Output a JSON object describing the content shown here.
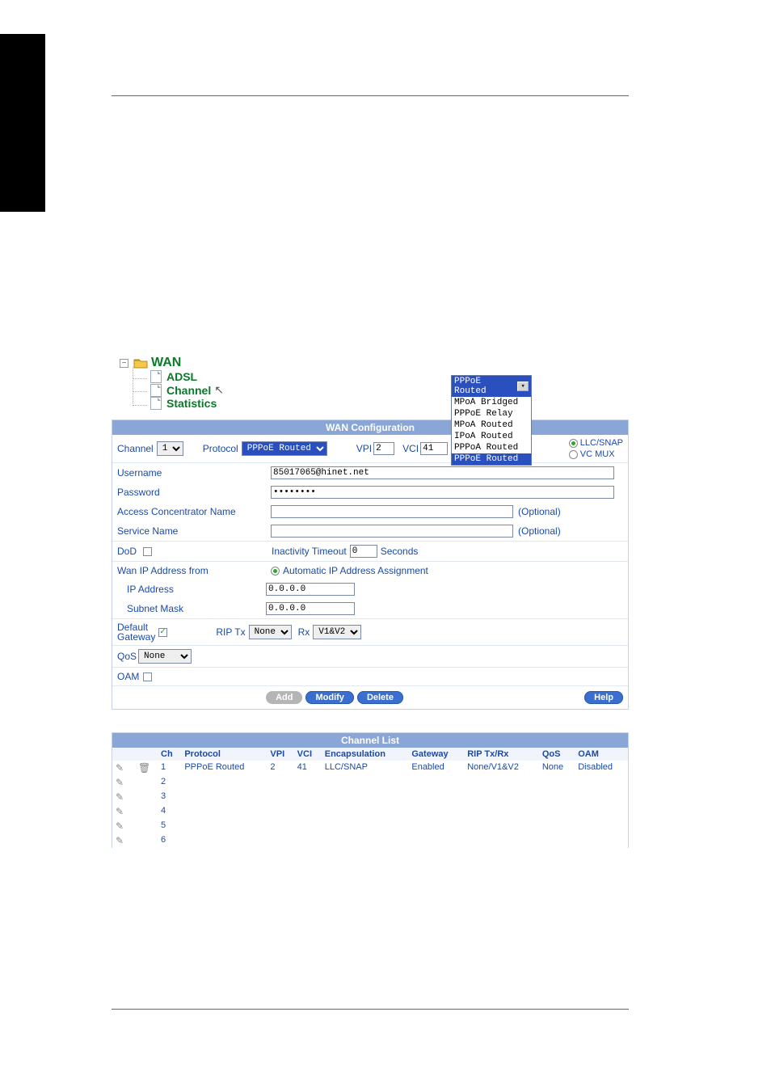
{
  "tree": {
    "root": "WAN",
    "items": [
      "ADSL",
      "Channel",
      "Statistics"
    ]
  },
  "protocol_dropdown": {
    "selected": "PPPoE Routed",
    "options": [
      "MPoA Bridged",
      "PPPoE Relay",
      "MPoA Routed",
      "IPoA Routed",
      "PPPoA Routed",
      "PPPoE Routed"
    ]
  },
  "wan_config": {
    "title": "WAN Configuration",
    "channel_label": "Channel",
    "channel_value": "1",
    "protocol_label": "Protocol",
    "protocol_value": "PPPoE Routed",
    "vpi_label": "VPI",
    "vpi_value": "2",
    "vci_label": "VCI",
    "vci_value": "41",
    "encaps": {
      "llc": "LLC/SNAP",
      "vcmux": "VC MUX"
    },
    "username_label": "Username",
    "username_value": "85017065@hinet.net",
    "password_label": "Password",
    "password_value": "••••••••",
    "acn_label": "Access Concentrator Name",
    "service_label": "Service Name",
    "optional": "(Optional)",
    "dod_label": "DoD",
    "inactivity_label": "Inactivity Timeout",
    "inactivity_value": "0",
    "seconds": "Seconds",
    "wanip_label": "Wan IP Address from",
    "auto_ip": "Automatic IP Address Assignment",
    "ip_label": "IP Address",
    "ip_value": "0.0.0.0",
    "mask_label": "Subnet Mask",
    "mask_value": "0.0.0.0",
    "defgw_label1": "Default",
    "defgw_label2": "Gateway",
    "riptx_label": "RIP Tx",
    "riptx_value": "None",
    "riprx_label": "Rx",
    "riprx_value": "V1&V2",
    "qos_label": "QoS",
    "qos_value": "None",
    "oam_label": "OAM",
    "buttons": {
      "add": "Add",
      "modify": "Modify",
      "delete": "Delete",
      "help": "Help"
    }
  },
  "channel_list": {
    "title": "Channel List",
    "headers": [
      "Ch",
      "Protocol",
      "VPI",
      "VCI",
      "Encapsulation",
      "Gateway",
      "RIP Tx/Rx",
      "QoS",
      "OAM"
    ],
    "rows": [
      {
        "ch": "1",
        "protocol": "PPPoE Routed",
        "vpi": "2",
        "vci": "41",
        "encap": "LLC/SNAP",
        "gateway": "Enabled",
        "rip": "None/V1&V2",
        "qos": "None",
        "oam": "Disabled",
        "has_trash": true
      },
      {
        "ch": "2"
      },
      {
        "ch": "3"
      },
      {
        "ch": "4"
      },
      {
        "ch": "5"
      },
      {
        "ch": "6"
      }
    ]
  }
}
